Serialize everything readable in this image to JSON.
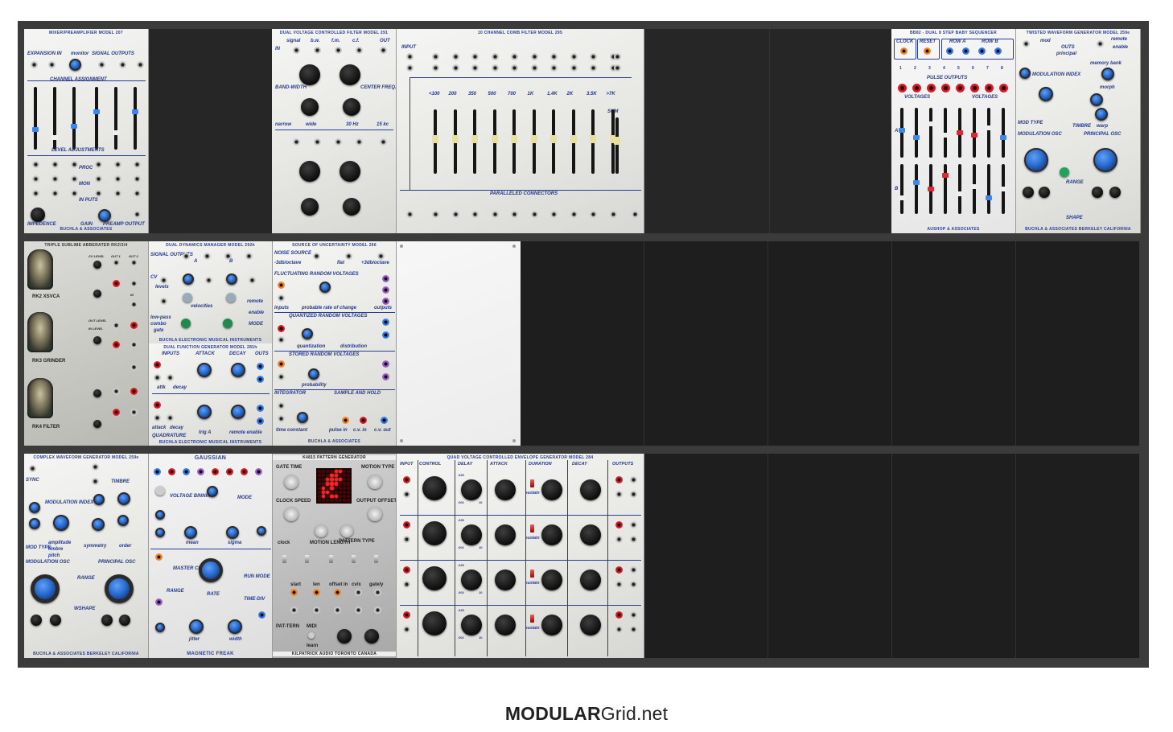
{
  "site": {
    "logo_bold": "MODULAR",
    "logo_rest": "Grid.net"
  },
  "row1": {
    "mixer": {
      "title": "MIXER/PREAMPLIFIER MODEL 207",
      "labels": [
        "EXPANSION IN",
        "monitor",
        "SIGNAL OUTPUTS",
        "CHANNEL ASSIGNMENT",
        "LEVEL ADJUSTMENTS",
        "PROC",
        "MON",
        "IN PUTS",
        "IMPEDENCE",
        "GAIN",
        "PREAMP OUTPUT"
      ],
      "maker": "BUCHLA & ASSOCIATES"
    },
    "dual_filter": {
      "title": "DUAL VOLTAGE CONTROLLED FILTER MODEL 291",
      "labels": [
        "signal",
        "b.w.",
        "f.m.",
        "c.f.",
        "OUT",
        "IN",
        "BAND-WIDTH",
        "CENTER FREQ.",
        "narrow",
        "wide",
        "30 Hz",
        "15 kc"
      ]
    },
    "comb": {
      "title": "10 CHANNEL COMB FILTER MODEL 295",
      "input": "INPUT",
      "bands": [
        "<100",
        "200",
        "350",
        "500",
        "700",
        "1K",
        "1.4K",
        "2K",
        "3.5K",
        ">7K"
      ],
      "sum": "SUM",
      "footer": "PARALLELED CONNECTORS"
    },
    "sequencer": {
      "title": "BB82 - DUAL 8 STEP BABY SEQUENCER",
      "labels": [
        "CLOCK",
        "RESET",
        "ROW A",
        "ROW B",
        "PULSE OUTPUTS",
        "VOLTAGES",
        "VOLTAGES"
      ],
      "rows": [
        "A",
        "B"
      ],
      "steps": [
        "1",
        "2",
        "3",
        "4",
        "5",
        "6",
        "7",
        "8"
      ],
      "maker": "AUSHOP & ASSOCIATES"
    },
    "twisted": {
      "title": "TWISTED WAVEFORM GENERATOR MODEL 259e",
      "labels": [
        "mod",
        "OUTS",
        "principal",
        "remote",
        "enable",
        "MODULATION INDEX",
        "memory bank",
        "morph",
        "TIMBRE",
        "warp",
        "MOD TYPE",
        "MODULATION OSC",
        "PRINCIPAL OSC",
        "RANGE",
        "SHAPE"
      ],
      "maker": "BUCHLA & ASSOCIATES   BERKELEY   CALIFORNIA"
    }
  },
  "row2": {
    "sublime": {
      "title": "TRIPLE SUBLIME ABBERATER RK2/3/4",
      "units": [
        "RK2 XSVCA",
        "RK3 GRINDER",
        "RK4 FILTER"
      ],
      "labels": [
        "OUT 1",
        "OUT 2",
        "IN",
        "CV LEVEL",
        "OUT LEVEL",
        "IN LEVEL"
      ]
    },
    "dyn_manager": {
      "title": "DUAL DYNAMICS MANAGER MODEL 292h",
      "labels": [
        "SIGNAL OUTPUTS",
        "A",
        "B",
        "CV",
        "levels",
        "velocities",
        "remote",
        "enable",
        "low-pass",
        "combo",
        "gate",
        "MODE"
      ],
      "maker": "BUCHLA ELECTRONIC MUSICAL INSTRUMENTS"
    },
    "func_gen": {
      "title": "DUAL FUNCTION GENERATOR MODEL 281h",
      "labels": [
        "INPUTS",
        "ATTACK",
        "DECAY",
        "OUTS",
        "attk",
        "decay",
        "attack",
        "decay",
        "trig A",
        "remote enable",
        "QUADRATURE"
      ],
      "maker": "BUCHLA ELECTRONIC MUSICAL INSTRUMENTS"
    },
    "uncertainty": {
      "title": "SOURCE OF UNCERTAINTY MODEL 266",
      "labels": [
        "NOISE SOURCE",
        "-3db/octave",
        "flat",
        "+3db/octave",
        "FLUCTUATING RANDOM VOLTAGES",
        "inputs",
        "probable rate of change",
        "outputs",
        "QUANTIZED RANDOM VOLTAGES",
        "quantization",
        "distribution",
        "STORED RANDOM VOLTAGES",
        "probability",
        "INTEGRATOR",
        "SAMPLE AND HOLD",
        "time constant",
        "pulse in",
        "c.v. in",
        "c.v. out"
      ],
      "maker": "BUCHLA & ASSOCIATES"
    }
  },
  "row3": {
    "complex": {
      "title": "COMPLEX WAVEFORM GENERATOR MODEL 259e",
      "labels": [
        "SYNC",
        "MODULATION INDEX",
        "TIMBRE",
        "MOD TYPE",
        "amplitude",
        "timbre",
        "pitch",
        "symmetry",
        "order",
        "MODULATION OSC",
        "PRINCIPAL OSC",
        "RANGE",
        "WSHAPE"
      ],
      "maker": "BUCHLA & ASSOCIATES   BERKELEY   CALIFORNIA"
    },
    "gaussian": {
      "title": "GAUSSIAN",
      "labels": [
        "VOLTAGE BINNING",
        "MODE",
        "mean",
        "sigma",
        "MASTER CLOCK",
        "RANGE",
        "RATE",
        "RUN MODE",
        "TIME-DIV",
        "jitter",
        "width"
      ],
      "maker": "MAGNETIC FREAK"
    },
    "pattern": {
      "title": "K4815 PATTERN GENERATOR",
      "labels": [
        "GATE TIME",
        "MOTION TYPE",
        "CLOCK SPEED",
        "OUTPUT OFFSET",
        "clock",
        "MOTION LENGTH",
        "PATTERN TYPE",
        "start",
        "len",
        "offset in",
        "cv/x",
        "gate/y",
        "MIDI",
        "learn",
        "PAT-TERN"
      ],
      "maker": "KILPATRICK AUDIO   TORONTO   CANADA"
    },
    "envelope": {
      "title": "QUAD VOLTAGE CONTROLLED ENVELOPE GENERATOR MODEL 284",
      "columns": [
        "INPUT",
        "CONTROL",
        "DELAY",
        "ATTACK",
        "DURATION",
        "DECAY",
        "OUTPUTS"
      ],
      "labels": [
        "sustain",
        ".025",
        ".002",
        "10"
      ]
    }
  },
  "colors": {
    "buchla_blue": "#2a3d8f",
    "rack_frame": "#3b3b3b",
    "empty_slot": "#1e1e1e"
  }
}
